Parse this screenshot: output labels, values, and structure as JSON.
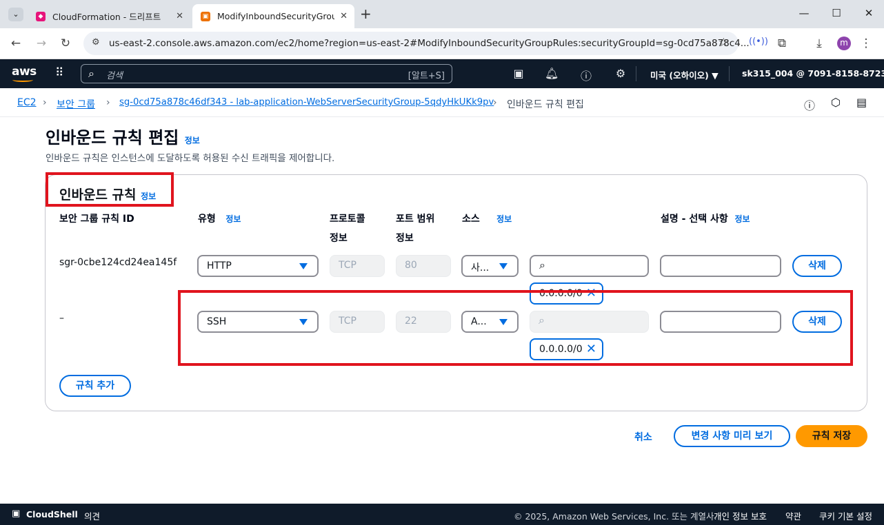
{
  "browser": {
    "tabs": [
      {
        "title": "CloudFormation - 드리프트",
        "favicon_color": "#e7157b"
      },
      {
        "title": "ModifyInboundSecurityGroupR",
        "favicon_color": "#ed7100"
      }
    ],
    "new_tab": "+",
    "url": "us-east-2.console.aws.amazon.com/ec2/home?region=us-east-2#ModifyInboundSecurityGroupRules:securityGroupId=sg-0cd75a878c4...",
    "profile_initial": "m"
  },
  "aws_header": {
    "logo": "aws",
    "search_placeholder": "검색",
    "search_shortcut": "[알트+S]",
    "region": "미국 (오하이오) ▼",
    "account": "sk315_004 @ 7091-8158-8723 ▼"
  },
  "breadcrumb": {
    "items": [
      "EC2",
      "보안 그룹",
      "sg-0cd75a878c46df343 - lab-application-WebServerSecurityGroup-5qdyHkUKk9pv"
    ],
    "current": "인바운드 규칙 편집"
  },
  "page": {
    "title": "인바운드 규칙 편집",
    "info": "정보",
    "subtitle": "인바운드 규칙은 인스턴스에 도달하도록 허용된 수신 트래픽을 제어합니다."
  },
  "panel": {
    "title": "인바운드 규칙",
    "info": "정보",
    "columns": {
      "rule_id": "보안 그룹 규칙 ID",
      "type": "유형",
      "protocol": "프로토콜",
      "port": "포트 범위",
      "source": "소스",
      "description": "설명 - 선택 사항",
      "info": "정보"
    },
    "rows": [
      {
        "rule_id": "sgr-0cbe124cd24ea145f",
        "type": "HTTP",
        "protocol": "TCP",
        "port": "80",
        "source": "사...",
        "cidr": "0.0.0.0/0",
        "delete": "삭제"
      },
      {
        "rule_id": "–",
        "type": "SSH",
        "protocol": "TCP",
        "port": "22",
        "source": "A...",
        "cidr": "0.0.0.0/0",
        "delete": "삭제"
      }
    ],
    "add_rule": "규칙 추가"
  },
  "actions": {
    "cancel": "취소",
    "preview": "변경 사항 미리 보기",
    "save": "규칙 저장"
  },
  "footer": {
    "cloudshell": "CloudShell",
    "feedback": "의견",
    "copyright": "© 2025, Amazon Web Services, Inc. 또는 계열사.",
    "privacy": "개인 정보 보호",
    "terms": "약관",
    "cookies": "쿠키 기본 설정"
  },
  "colors": {
    "accent": "#006ce0",
    "primary_button": "#ff9900",
    "highlight": "#e0141e",
    "header_bg": "#0f1b2a"
  }
}
